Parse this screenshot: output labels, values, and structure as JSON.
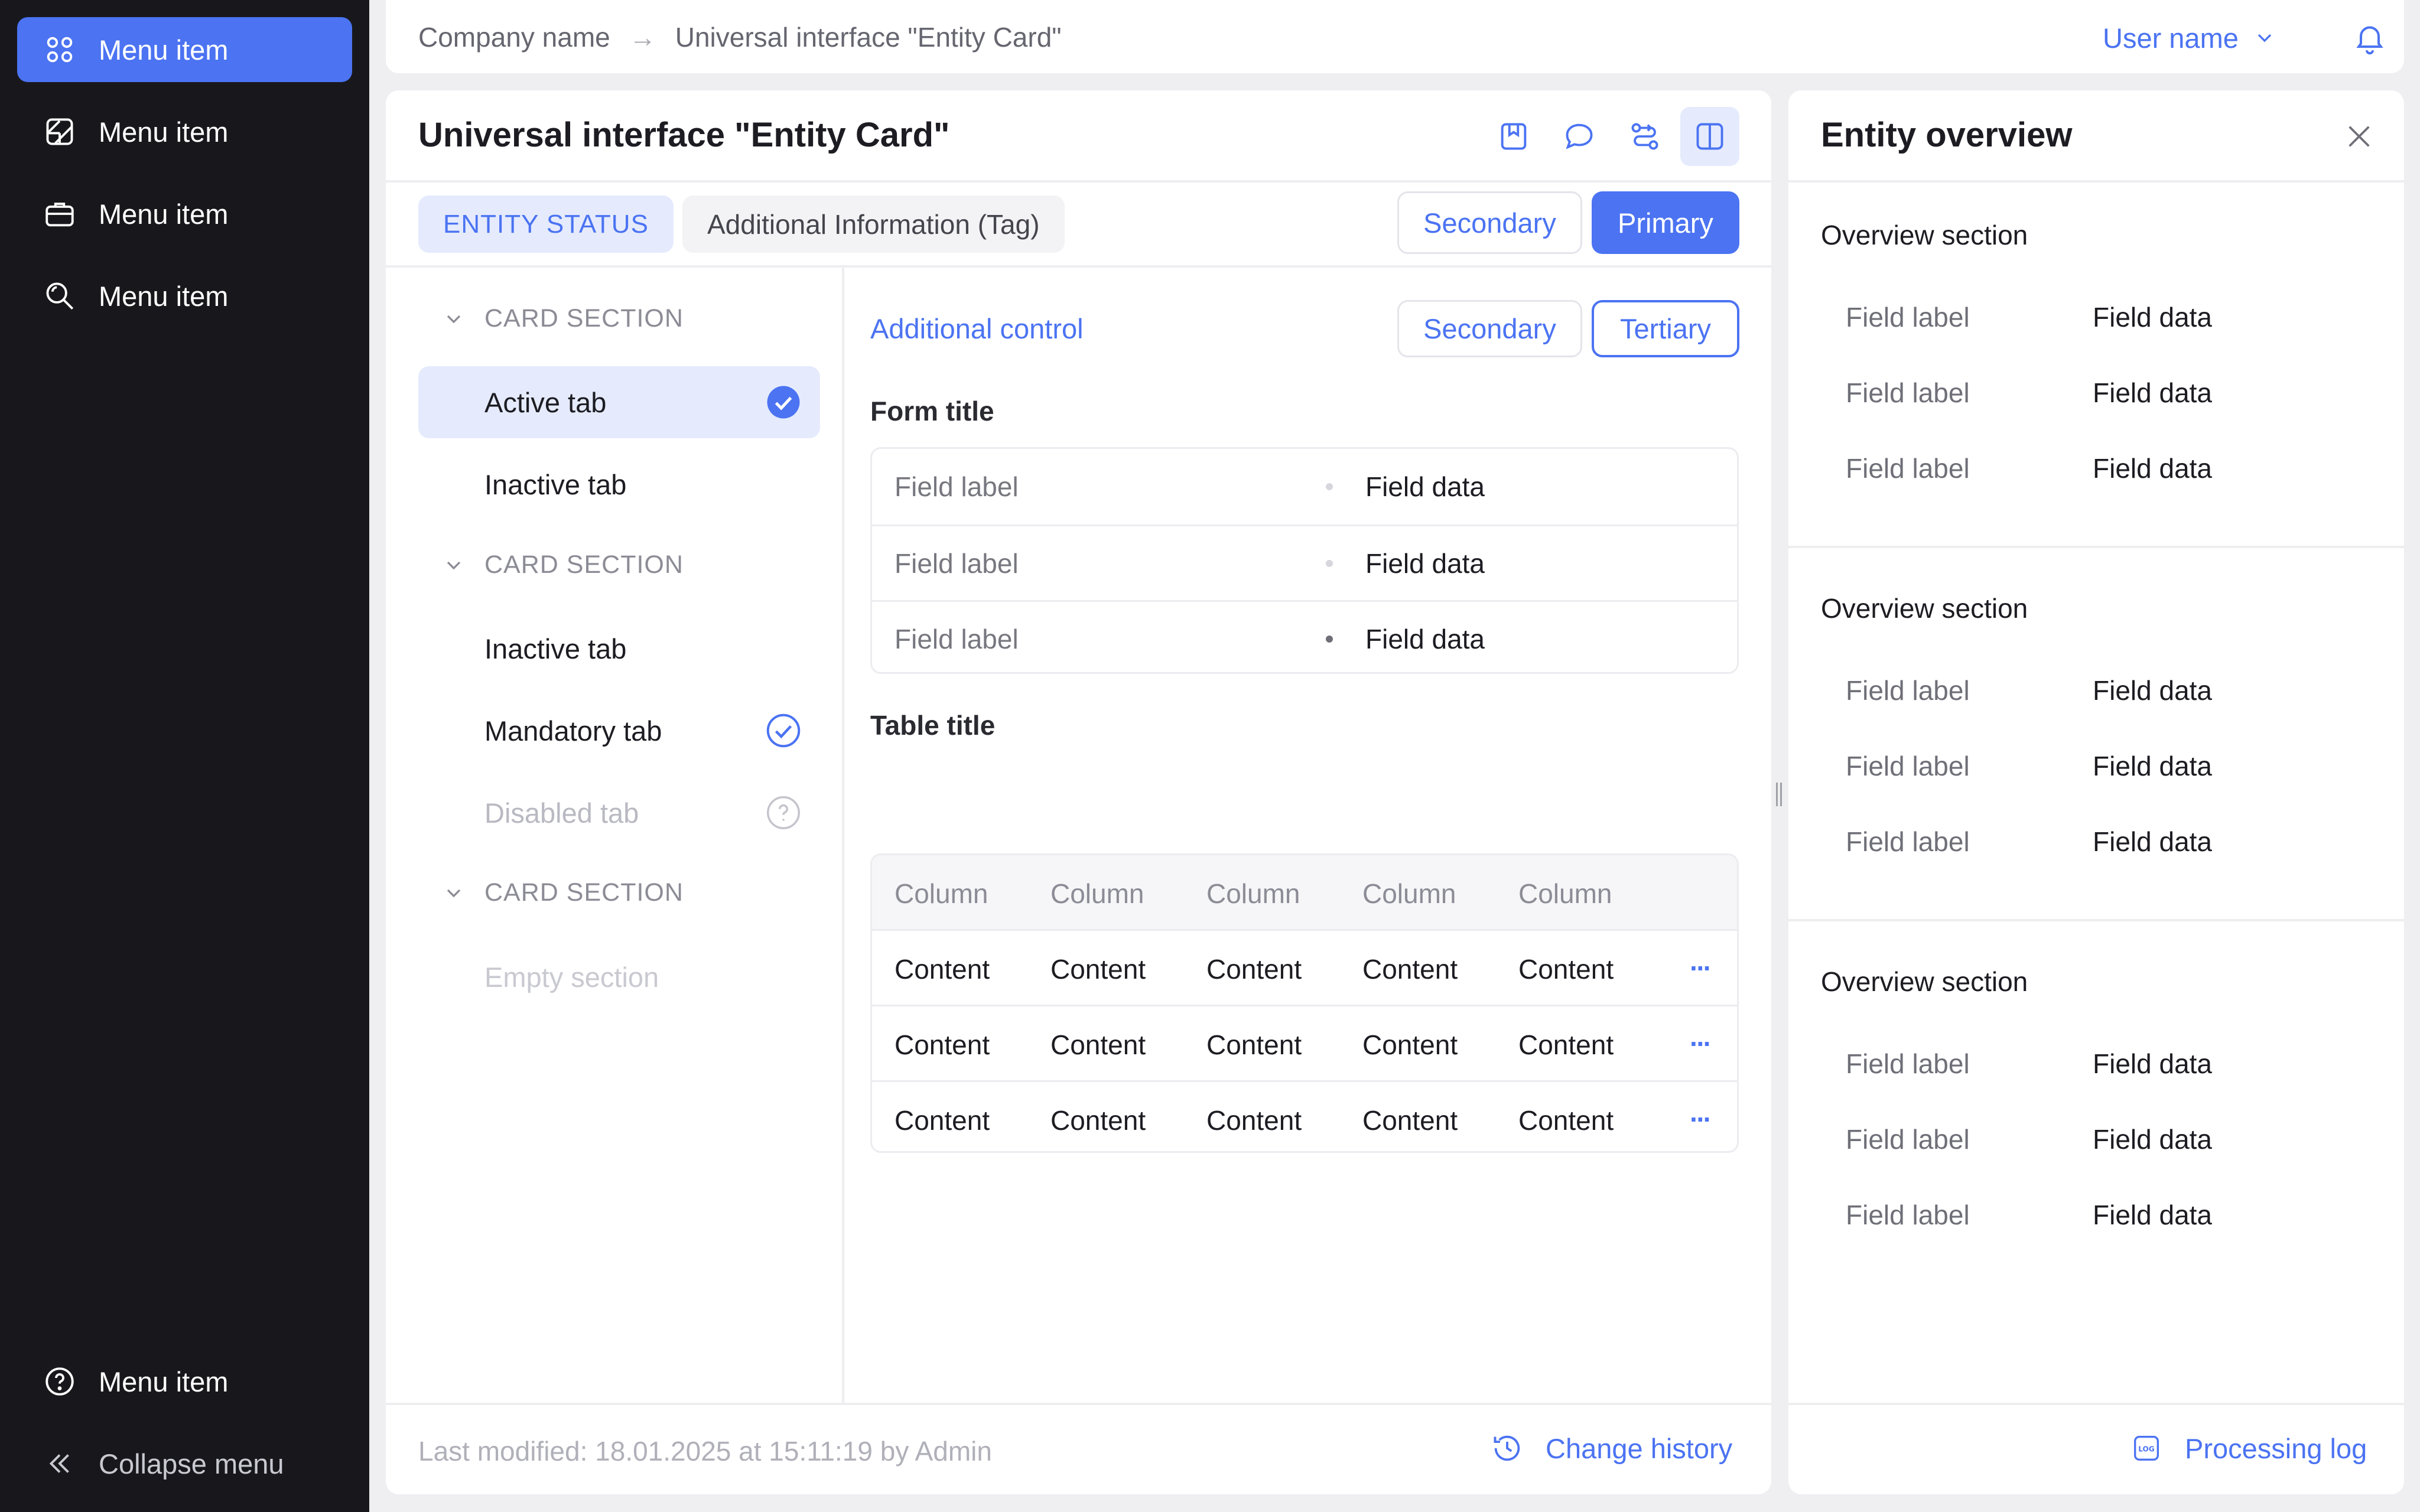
{
  "sidebar": {
    "items": [
      {
        "label": "Menu item",
        "icon": "apps-icon"
      },
      {
        "label": "Menu item",
        "icon": "document-edit-icon"
      },
      {
        "label": "Menu item",
        "icon": "briefcase-icon"
      },
      {
        "label": "Menu item",
        "icon": "search-icon"
      }
    ],
    "help_item": {
      "label": "Menu item",
      "icon": "help-icon"
    },
    "collapse_label": "Collapse menu"
  },
  "header": {
    "breadcrumb": [
      "Company name",
      "Universal interface \"Entity Card\""
    ],
    "breadcrumb_separator": "→",
    "user_name": "User name"
  },
  "card": {
    "title": "Universal interface \"Entity Card\"",
    "status": "ENTITY STATUS",
    "tag": "Additional Information (Tag)",
    "secondary_label": "Secondary",
    "primary_label": "Primary",
    "sections": [
      {
        "title": "CARD SECTION"
      },
      {
        "title": "CARD SECTION"
      },
      {
        "title": "CARD SECTION"
      }
    ],
    "tabs": {
      "active": "Active tab",
      "inactive_1": "Inactive tab",
      "inactive_2": "Inactive tab",
      "mandatory": "Mandatory tab",
      "disabled": "Disabled tab",
      "empty": "Empty section"
    },
    "additional_control": "Additional control",
    "secondary_label_2": "Secondary",
    "tertiary_label": "Tertiary",
    "form_title": "Form title",
    "form_rows": [
      {
        "label": "Field label",
        "value": "Field data"
      },
      {
        "label": "Field label",
        "value": "Field data"
      },
      {
        "label": "Field label",
        "value": "Field data"
      }
    ],
    "table_title": "Table title",
    "table": {
      "columns": [
        "Column",
        "Column",
        "Column",
        "Column",
        "Column"
      ],
      "rows": [
        [
          "Content",
          "Content",
          "Content",
          "Content",
          "Content"
        ],
        [
          "Content",
          "Content",
          "Content",
          "Content",
          "Content"
        ],
        [
          "Content",
          "Content",
          "Content",
          "Content",
          "Content"
        ]
      ],
      "row_action": "···"
    },
    "last_modified": "Last modified: 18.01.2025 at 15:11:19 by Admin",
    "change_history": "Change history"
  },
  "panel": {
    "title": "Entity overview",
    "sections": [
      {
        "title": "Overview section",
        "rows": [
          {
            "label": "Field label",
            "value": "Field data"
          },
          {
            "label": "Field label",
            "value": "Field data"
          },
          {
            "label": "Field label",
            "value": "Field data"
          }
        ]
      },
      {
        "title": "Overview section",
        "rows": [
          {
            "label": "Field label",
            "value": "Field data"
          },
          {
            "label": "Field label",
            "value": "Field data"
          },
          {
            "label": "Field label",
            "value": "Field data"
          }
        ]
      },
      {
        "title": "Overview section",
        "rows": [
          {
            "label": "Field label",
            "value": "Field data"
          },
          {
            "label": "Field label",
            "value": "Field data"
          },
          {
            "label": "Field label",
            "value": "Field data"
          }
        ]
      }
    ],
    "processing_log": "Processing log",
    "log_icon_text": "LOG"
  },
  "colors": {
    "accent": "#4b73f2",
    "sidebar_bg": "#18181c",
    "page_bg": "#efeff2"
  }
}
